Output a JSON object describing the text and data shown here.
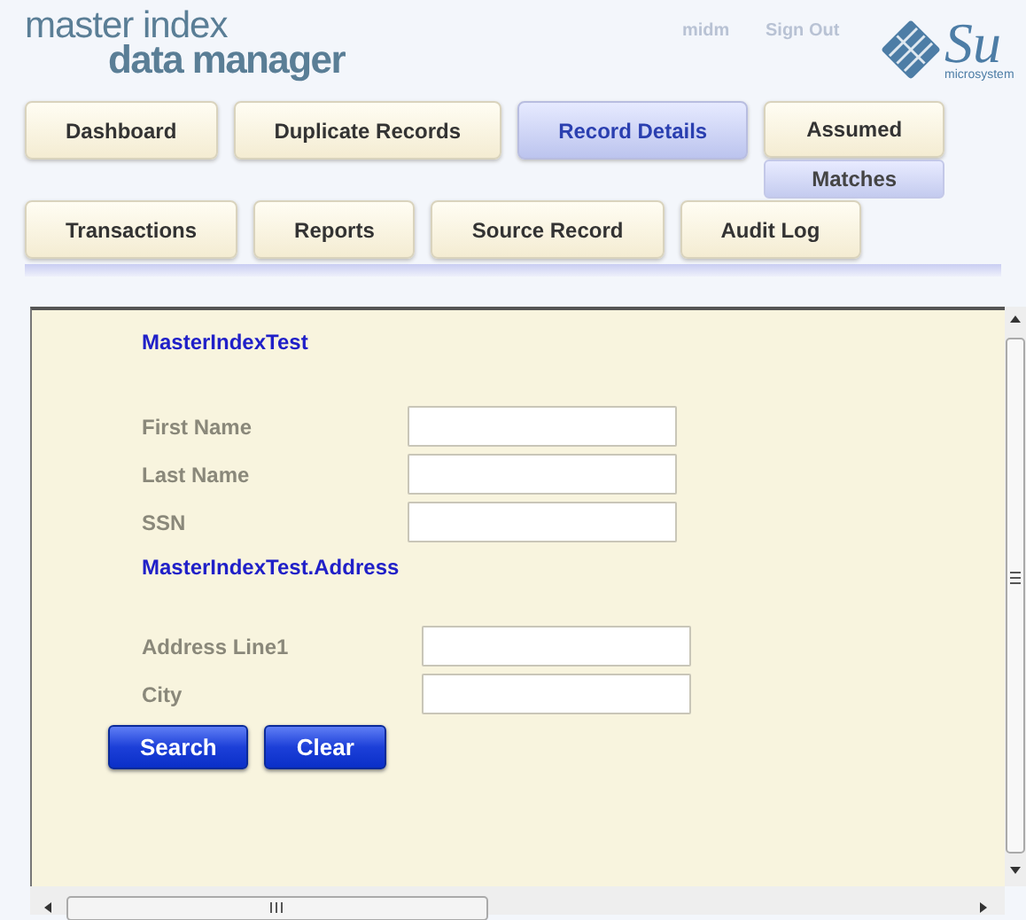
{
  "header": {
    "logo_top": "master index",
    "logo_bottom": "data manager",
    "user": "midm",
    "sign_out": "Sign Out",
    "brand": "Su",
    "brand_sub": "microsystem"
  },
  "tab_rows": [
    {
      "tabs": [
        {
          "label": "Dashboard",
          "selected": false
        },
        {
          "label": "Duplicate Records",
          "selected": false
        },
        {
          "label": "Record Details",
          "selected": true
        },
        {
          "label": "Assumed",
          "selected": false,
          "overflow": "Matches"
        }
      ]
    },
    {
      "tabs": [
        {
          "label": "Transactions",
          "selected": false
        },
        {
          "label": "Reports",
          "selected": false
        },
        {
          "label": "Source Record",
          "selected": false
        },
        {
          "label": "Audit Log",
          "selected": false
        }
      ]
    }
  ],
  "sections": [
    {
      "title": "MasterIndexTest",
      "fields": [
        {
          "label": "First Name"
        },
        {
          "label": "Last Name"
        },
        {
          "label": "SSN"
        }
      ]
    },
    {
      "title": "MasterIndexTest.Address",
      "fields": [
        {
          "label": "Address Line1"
        },
        {
          "label": "City"
        }
      ]
    }
  ],
  "buttons": [
    "Search",
    "Clear"
  ]
}
